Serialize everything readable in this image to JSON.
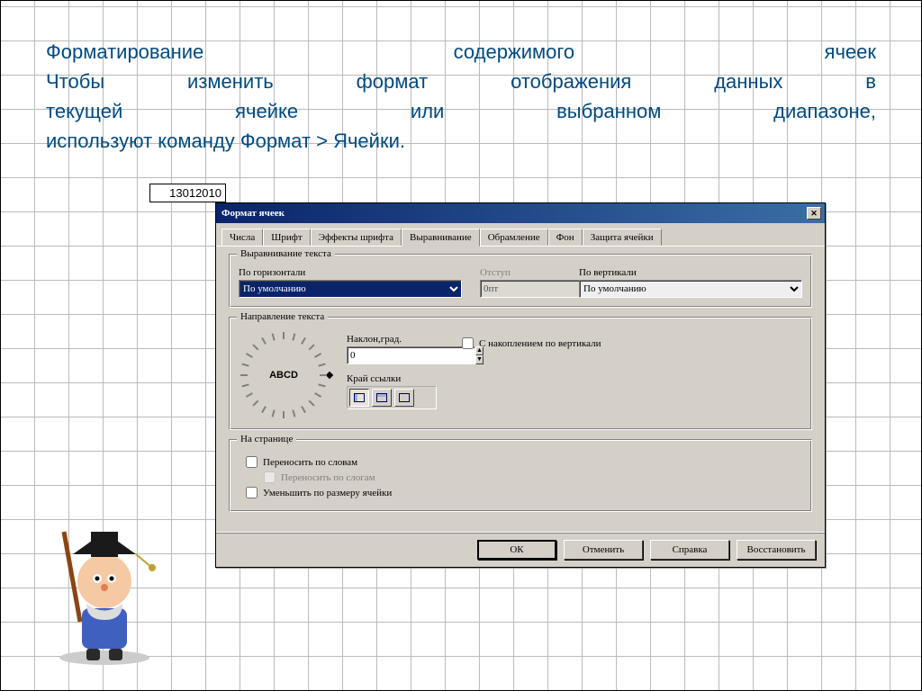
{
  "heading": {
    "l1": "Форматирование содержимого ячеек",
    "l2": "Чтобы изменить формат отображения данных в",
    "l3": "текущей ячейке или выбранном диапазоне,",
    "l4": "используют команду Формат > Ячейки."
  },
  "cell_value": "13012010",
  "dialog": {
    "title": "Формат ячеек",
    "close": "✕",
    "tabs": [
      "Числа",
      "Шрифт",
      "Эффекты шрифта",
      "Выравнивание",
      "Обрамление",
      "Фон",
      "Защита ячейки"
    ],
    "active_tab": "Выравнивание",
    "align": {
      "group": "Выравнивание текста",
      "horiz_lbl": "По горизонтали",
      "horiz_val": "По умолчанию",
      "indent_lbl": "Отступ",
      "indent_val": "0пт",
      "vert_lbl": "По вертикали",
      "vert_val": "По умолчанию"
    },
    "dir": {
      "group": "Направление текста",
      "dial": "ABCD",
      "angle_lbl": "Наклон,град.",
      "angle_val": "0",
      "stack_lbl": "С накоплением по вертикали",
      "edge_lbl": "Край ссылки"
    },
    "page": {
      "group": "На странице",
      "wrap": "Переносить по словам",
      "hyph": "Переносить по слогам",
      "shrink": "Уменьшить по размеру ячейки"
    },
    "buttons": {
      "ok": "ОК",
      "cancel": "Отменить",
      "help": "Справка",
      "reset": "Восстановить"
    }
  }
}
